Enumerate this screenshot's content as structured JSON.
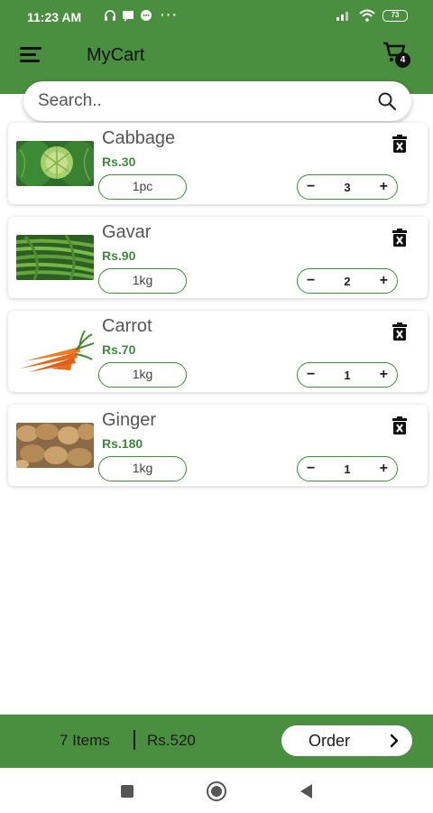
{
  "status_bar": {
    "time": "11:23 AM",
    "dots": "···",
    "battery": "73"
  },
  "app": {
    "title": "MyCart",
    "cart_count": "4"
  },
  "search": {
    "placeholder": "Search.."
  },
  "items": [
    {
      "name": "Cabbage",
      "price": "Rs.30",
      "unit": "1pc",
      "quantity": "3",
      "image": "cabbage"
    },
    {
      "name": "Gavar",
      "price": "Rs.90",
      "unit": "1kg",
      "quantity": "2",
      "image": "gavar-beans"
    },
    {
      "name": "Carrot",
      "price": "Rs.70",
      "unit": "1kg",
      "quantity": "1",
      "image": "carrot"
    },
    {
      "name": "Ginger",
      "price": "Rs.180",
      "unit": "1kg",
      "quantity": "1",
      "image": "ginger"
    }
  ],
  "stepper": {
    "minus": "−",
    "plus": "+"
  },
  "footer": {
    "item_count": "7 Items",
    "total": "Rs.520",
    "order_label": "Order"
  },
  "colors": {
    "brand_green": "#4a8f3f",
    "price_green": "#3f8a3b"
  }
}
